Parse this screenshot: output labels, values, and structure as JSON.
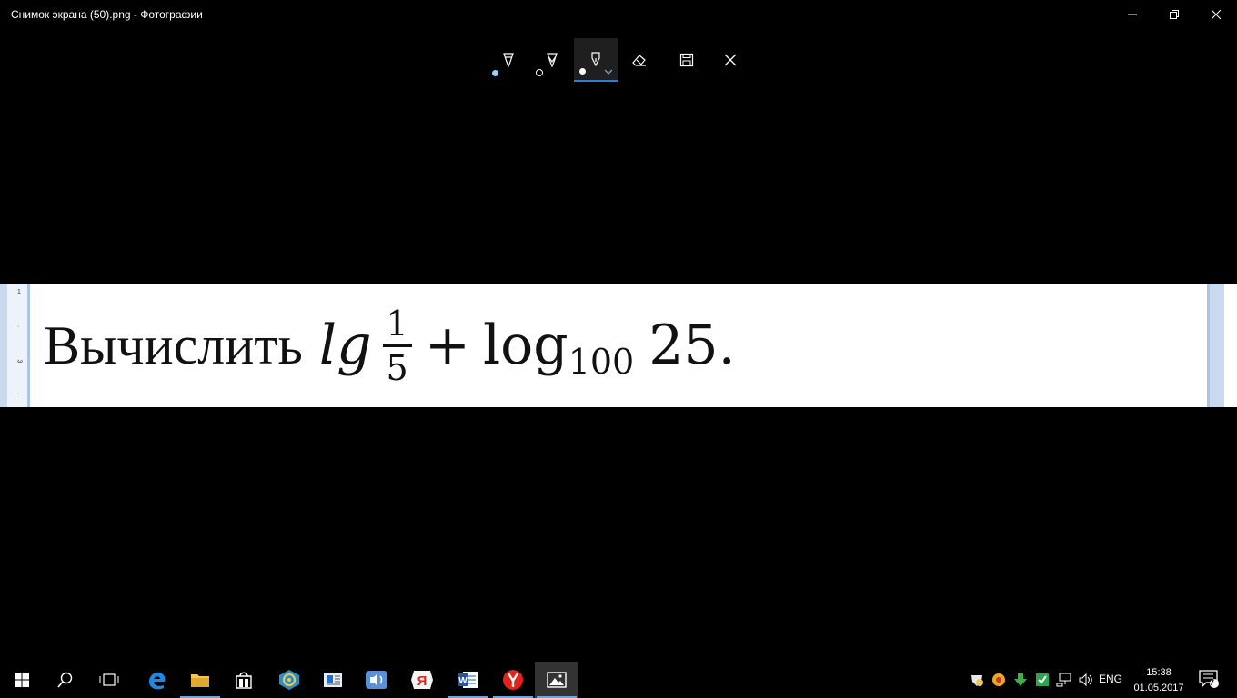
{
  "window": {
    "title": "Снимок экрана (50).png - Фотографии"
  },
  "formula": {
    "word": "Вычислить",
    "lg": "lg",
    "frac_num": "1",
    "frac_den": "5",
    "plus": "+",
    "log": "log",
    "base": "100",
    "arg": "25."
  },
  "ruler": {
    "mark_1": "1",
    "mark_2": "·",
    "mark_3": "3",
    "mark_4": "·"
  },
  "toolbar": {
    "tools": [
      {
        "name": "ballpoint-pen",
        "color": "#8fd3ff"
      },
      {
        "name": "pencil",
        "color": "#ffffff"
      },
      {
        "name": "calligraphy-pen",
        "color": "#ffffff"
      },
      {
        "name": "eraser"
      },
      {
        "name": "save"
      },
      {
        "name": "close"
      }
    ],
    "accent": "#2d7dd2"
  },
  "taskbar": {
    "language": "ENG",
    "time": "15:38",
    "date": "01.05.2017",
    "notification_count": "7"
  }
}
